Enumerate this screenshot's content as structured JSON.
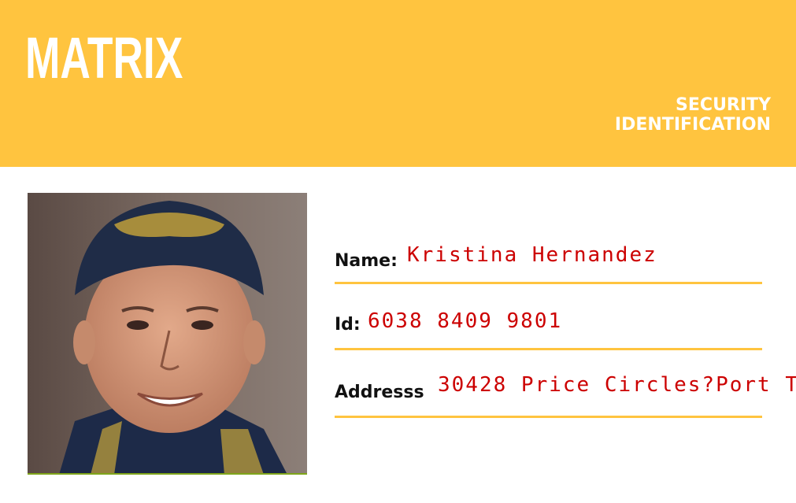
{
  "header": {
    "brand": "MATRIX",
    "subtitle_line1": "SECURITY",
    "subtitle_line2": "IDENTIFICATION"
  },
  "photo": {
    "description_icon": "portrait-photo"
  },
  "fields": {
    "name_label": "Name:",
    "name_value": "Kristina Hernandez",
    "id_label": "Id:",
    "id_value": "6038 8409 9801",
    "address_label": "Addresss",
    "address_value": "30428 Price Circles?Port T"
  },
  "colors": {
    "header_bg": "#FFC43F",
    "value_text": "#cc0000",
    "rule": "#FFC43F"
  }
}
